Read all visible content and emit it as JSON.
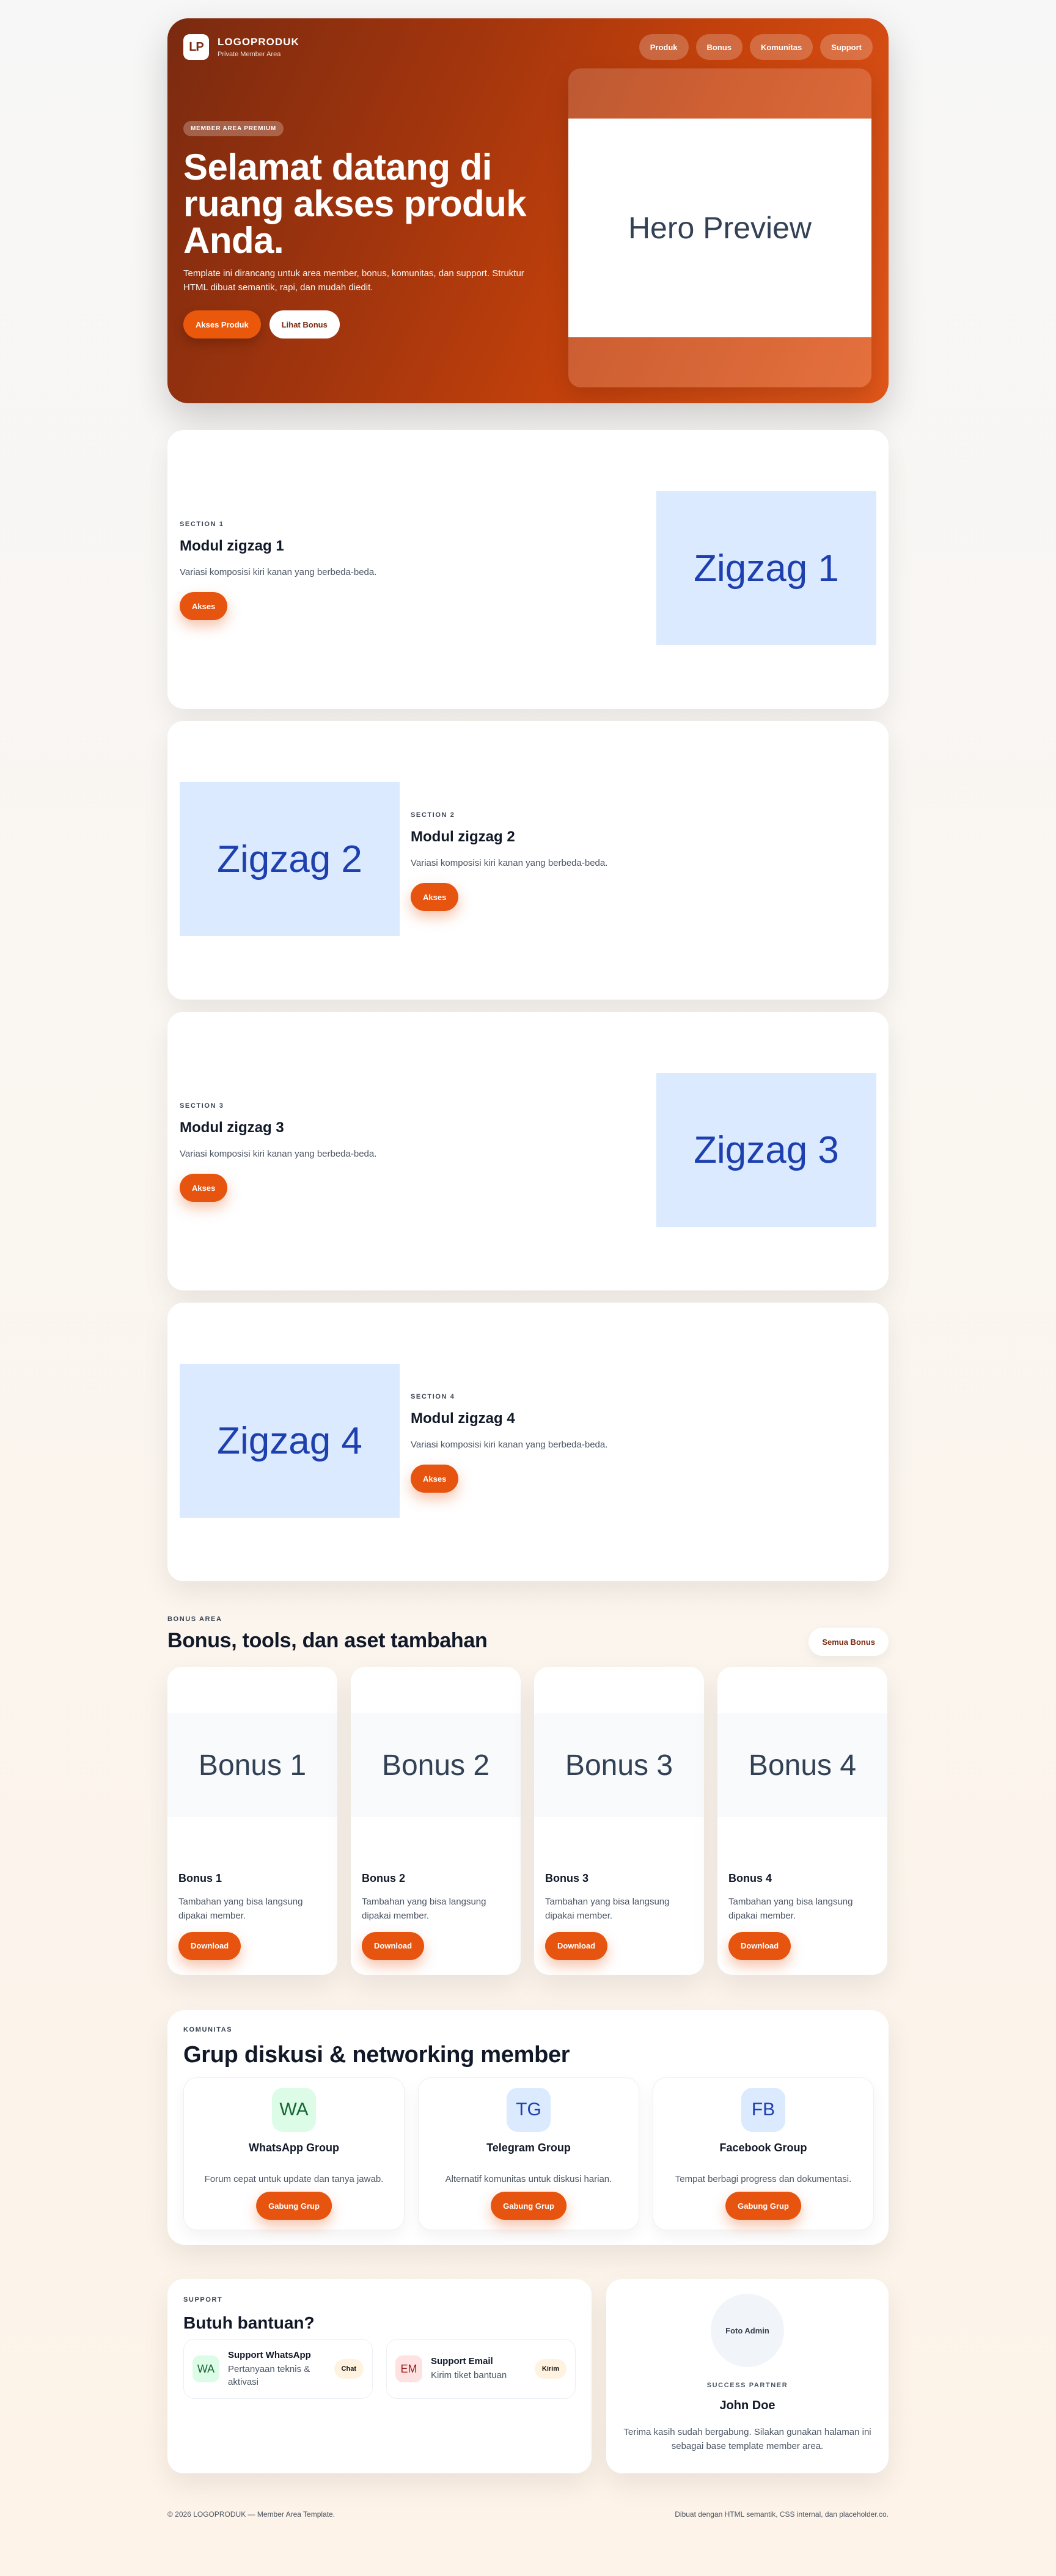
{
  "brand": {
    "logo": "LP",
    "name": "LOGOPRODUK",
    "subtitle": "Private Member Area"
  },
  "nav": [
    "Produk",
    "Bonus",
    "Komunitas",
    "Support"
  ],
  "hero": {
    "badge": "MEMBER AREA PREMIUM",
    "title": "Selamat datang di ruang akses produk Anda.",
    "text": "Template ini dirancang untuk area member, bonus, komunitas, dan support. Struktur HTML dibuat semantik, rapi, dan mudah diedit.",
    "primary": "Akses Produk",
    "secondary": "Lihat Bonus",
    "preview": "Hero Preview"
  },
  "zigzag": [
    {
      "label": "SECTION 1",
      "title": "Modul zigzag 1",
      "desc": "Variasi komposisi kiri kanan yang berbeda-beda.",
      "button": "Akses",
      "image": "Zigzag 1"
    },
    {
      "label": "SECTION 2",
      "title": "Modul zigzag 2",
      "desc": "Variasi komposisi kiri kanan yang berbeda-beda.",
      "button": "Akses",
      "image": "Zigzag 2"
    },
    {
      "label": "SECTION 3",
      "title": "Modul zigzag 3",
      "desc": "Variasi komposisi kiri kanan yang berbeda-beda.",
      "button": "Akses",
      "image": "Zigzag 3"
    },
    {
      "label": "SECTION 4",
      "title": "Modul zigzag 4",
      "desc": "Variasi komposisi kiri kanan yang berbeda-beda.",
      "button": "Akses",
      "image": "Zigzag 4"
    }
  ],
  "bonus": {
    "label": "BONUS AREA",
    "title": "Bonus, tools, dan aset tambahan",
    "all_button": "Semua Bonus",
    "items": [
      {
        "image": "Bonus 1",
        "name": "Bonus 1",
        "desc": "Tambahan yang bisa langsung dipakai member.",
        "button": "Download"
      },
      {
        "image": "Bonus 2",
        "name": "Bonus 2",
        "desc": "Tambahan yang bisa langsung dipakai member.",
        "button": "Download"
      },
      {
        "image": "Bonus 3",
        "name": "Bonus 3",
        "desc": "Tambahan yang bisa langsung dipakai member.",
        "button": "Download"
      },
      {
        "image": "Bonus 4",
        "name": "Bonus 4",
        "desc": "Tambahan yang bisa langsung dipakai member.",
        "button": "Download"
      }
    ]
  },
  "community": {
    "label": "KOMUNITAS",
    "title": "Grup diskusi & networking member",
    "groups": [
      {
        "icon": "WA",
        "name": "WhatsApp Group",
        "desc": "Forum cepat untuk update dan tanya jawab.",
        "button": "Gabung Grup"
      },
      {
        "icon": "TG",
        "name": "Telegram Group",
        "desc": "Alternatif komunitas untuk diskusi harian.",
        "button": "Gabung Grup"
      },
      {
        "icon": "FB",
        "name": "Facebook Group",
        "desc": "Tempat berbagi progress dan dokumentasi.",
        "button": "Gabung Grup"
      }
    ]
  },
  "support": {
    "label": "SUPPORT",
    "title": "Butuh bantuan?",
    "items": [
      {
        "icon": "WA",
        "name": "Support WhatsApp",
        "desc": "Pertanyaan teknis & aktivasi",
        "button": "Chat"
      },
      {
        "icon": "EM",
        "name": "Support Email",
        "desc": "Kirim tiket bantuan",
        "button": "Kirim"
      }
    ]
  },
  "partner": {
    "photo": "Foto Admin",
    "label": "SUCCESS PARTNER",
    "name": "John Doe",
    "desc": "Terima kasih sudah bergabung. Silakan gunakan halaman ini sebagai base template member area."
  },
  "footer": {
    "left": "© 2026 LOGOPRODUK — Member Area Template.",
    "right": "Dibuat dengan HTML semantik, CSS internal, dan placeholder.co."
  },
  "colors": {
    "accent": "#ea580c",
    "hero_dark": "#7a2a10",
    "zigzag_image_bg": "#dbeafe",
    "zigzag_image_text": "#1e40af",
    "wa_bg": "#dcfce7",
    "wa_text": "#166534",
    "tg_bg": "#dbeafe",
    "tg_text": "#1e40af",
    "fb_bg": "#dbeafe",
    "fb_text": "#1e40af",
    "em_bg": "#fee2e2",
    "em_text": "#991b1b"
  }
}
